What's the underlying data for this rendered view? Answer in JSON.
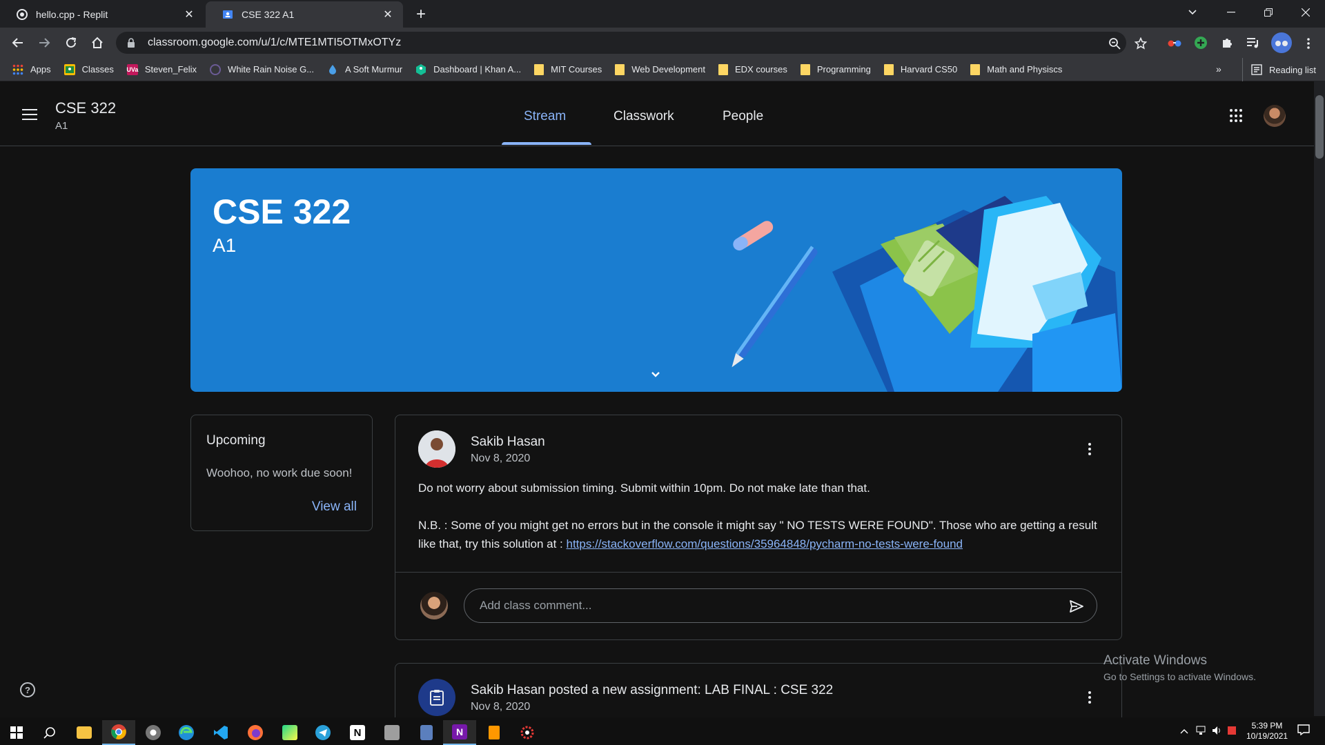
{
  "browser": {
    "tabs": [
      {
        "title": "hello.cpp - Replit",
        "icon": "replit-icon"
      },
      {
        "title": "CSE 322 A1",
        "icon": "classroom-icon"
      }
    ],
    "url": "classroom.google.com/u/1/c/MTE1MTI5OTMxOTYz",
    "bookmarks": [
      {
        "label": "Apps",
        "icon": "apps-grid-icon"
      },
      {
        "label": "Classes",
        "icon": "classroom-icon"
      },
      {
        "label": "Steven_Felix",
        "icon": "uva-icon"
      },
      {
        "label": "White Rain Noise G...",
        "icon": "noise-icon"
      },
      {
        "label": "A Soft Murmur",
        "icon": "drop-icon"
      },
      {
        "label": "Dashboard | Khan A...",
        "icon": "khan-icon"
      },
      {
        "label": "MIT Courses",
        "icon": "folder-icon"
      },
      {
        "label": "Web Development",
        "icon": "folder-icon"
      },
      {
        "label": "EDX courses",
        "icon": "folder-icon"
      },
      {
        "label": "Programming",
        "icon": "folder-icon"
      },
      {
        "label": "Harvard CS50",
        "icon": "folder-icon"
      },
      {
        "label": "Math and Physiscs",
        "icon": "folder-icon"
      }
    ],
    "more_bookmarks": "»",
    "reading_list": "Reading list"
  },
  "header": {
    "class_name": "CSE 322",
    "section": "A1",
    "tabs": [
      "Stream",
      "Classwork",
      "People"
    ],
    "active_tab": "Stream"
  },
  "banner": {
    "title": "CSE 322",
    "section": "A1",
    "color": "#1a7dd0"
  },
  "upcoming": {
    "title": "Upcoming",
    "text": "Woohoo, no work due soon!",
    "link": "View all"
  },
  "post": {
    "author": "Sakib Hasan",
    "date": "Nov 8, 2020",
    "line1": "Do not worry about submission timing. Submit within 10pm. Do not make late than that.",
    "line2": "N.B. : Some of you might get no errors but in the console it might say \" NO TESTS WERE FOUND\". Those who are getting a result like that, try this solution at : ",
    "link": "https://stackoverflow.com/questions/35964848/pycharm-no-tests-were-found",
    "comment_placeholder": "Add class comment..."
  },
  "assignment": {
    "title": "Sakib Hasan posted a new assignment: LAB FINAL : CSE 322",
    "date": "Nov 8, 2020"
  },
  "watermark": {
    "line1": "Activate Windows",
    "line2": "Go to Settings to activate Windows."
  },
  "taskbar": {
    "time": "5:39 PM",
    "date": "10/19/2021"
  },
  "colors": {
    "accent": "#8ab4f8",
    "background": "#121212"
  }
}
